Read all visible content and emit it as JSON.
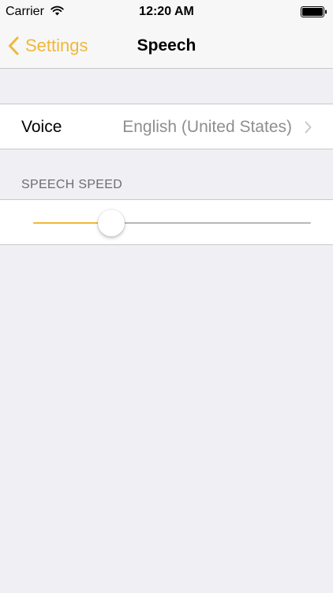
{
  "status_bar": {
    "carrier": "Carrier",
    "wifi_icon": "wifi-icon",
    "time": "12:20 AM",
    "battery_icon": "battery-icon"
  },
  "nav": {
    "back_label": "Settings",
    "back_icon": "chevron-left-icon",
    "title": "Speech"
  },
  "voice": {
    "label": "Voice",
    "value": "English (United States)",
    "icon": "chevron-right-icon"
  },
  "speech_speed": {
    "header": "SPEECH SPEED",
    "value": 0.28
  },
  "colors": {
    "accent": "#f0b83a",
    "background": "#efeff4",
    "separator": "#c8c7cc",
    "secondary_text": "#8e8e93",
    "track": "#b8b8bc"
  }
}
